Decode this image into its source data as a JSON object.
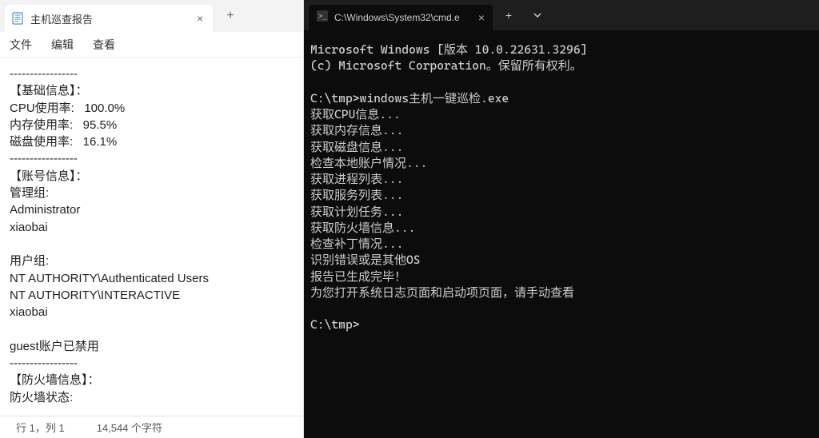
{
  "notepad": {
    "tab": {
      "title": "主机巡查报告"
    },
    "menu": {
      "file": "文件",
      "edit": "编辑",
      "view": "查看"
    },
    "content": "-----------------\n【基础信息】：\nCPU使用率:   100.0%\n内存使用率:   95.5%\n磁盘使用率:   16.1%\n-----------------\n【账号信息】：\n管理组:\nAdministrator\nxiaobai\n\n用户组:\nNT AUTHORITY\\Authenticated Users\nNT AUTHORITY\\INTERACTIVE\nxiaobai\n\nguest账户已禁用\n-----------------\n【防火墙信息】：\n防火墙状态:",
    "status": {
      "position": "行 1，列 1",
      "chars": "14,544 个字符"
    }
  },
  "terminal": {
    "tab": {
      "title": "C:\\Windows\\System32\\cmd.e"
    },
    "content": "Microsoft Windows [版本 10.0.22631.3296]\n(c) Microsoft Corporation。保留所有权利。\n\nC:\\tmp>windows主机一键巡检.exe\n获取CPU信息...\n获取内存信息...\n获取磁盘信息...\n检查本地账户情况...\n获取进程列表...\n获取服务列表...\n获取计划任务...\n获取防火墙信息...\n检查补丁情况...\n识别错误或是其他OS\n报告已生成完毕！\n为您打开系统日志页面和启动项页面，请手动查看\n\nC:\\tmp>"
  }
}
